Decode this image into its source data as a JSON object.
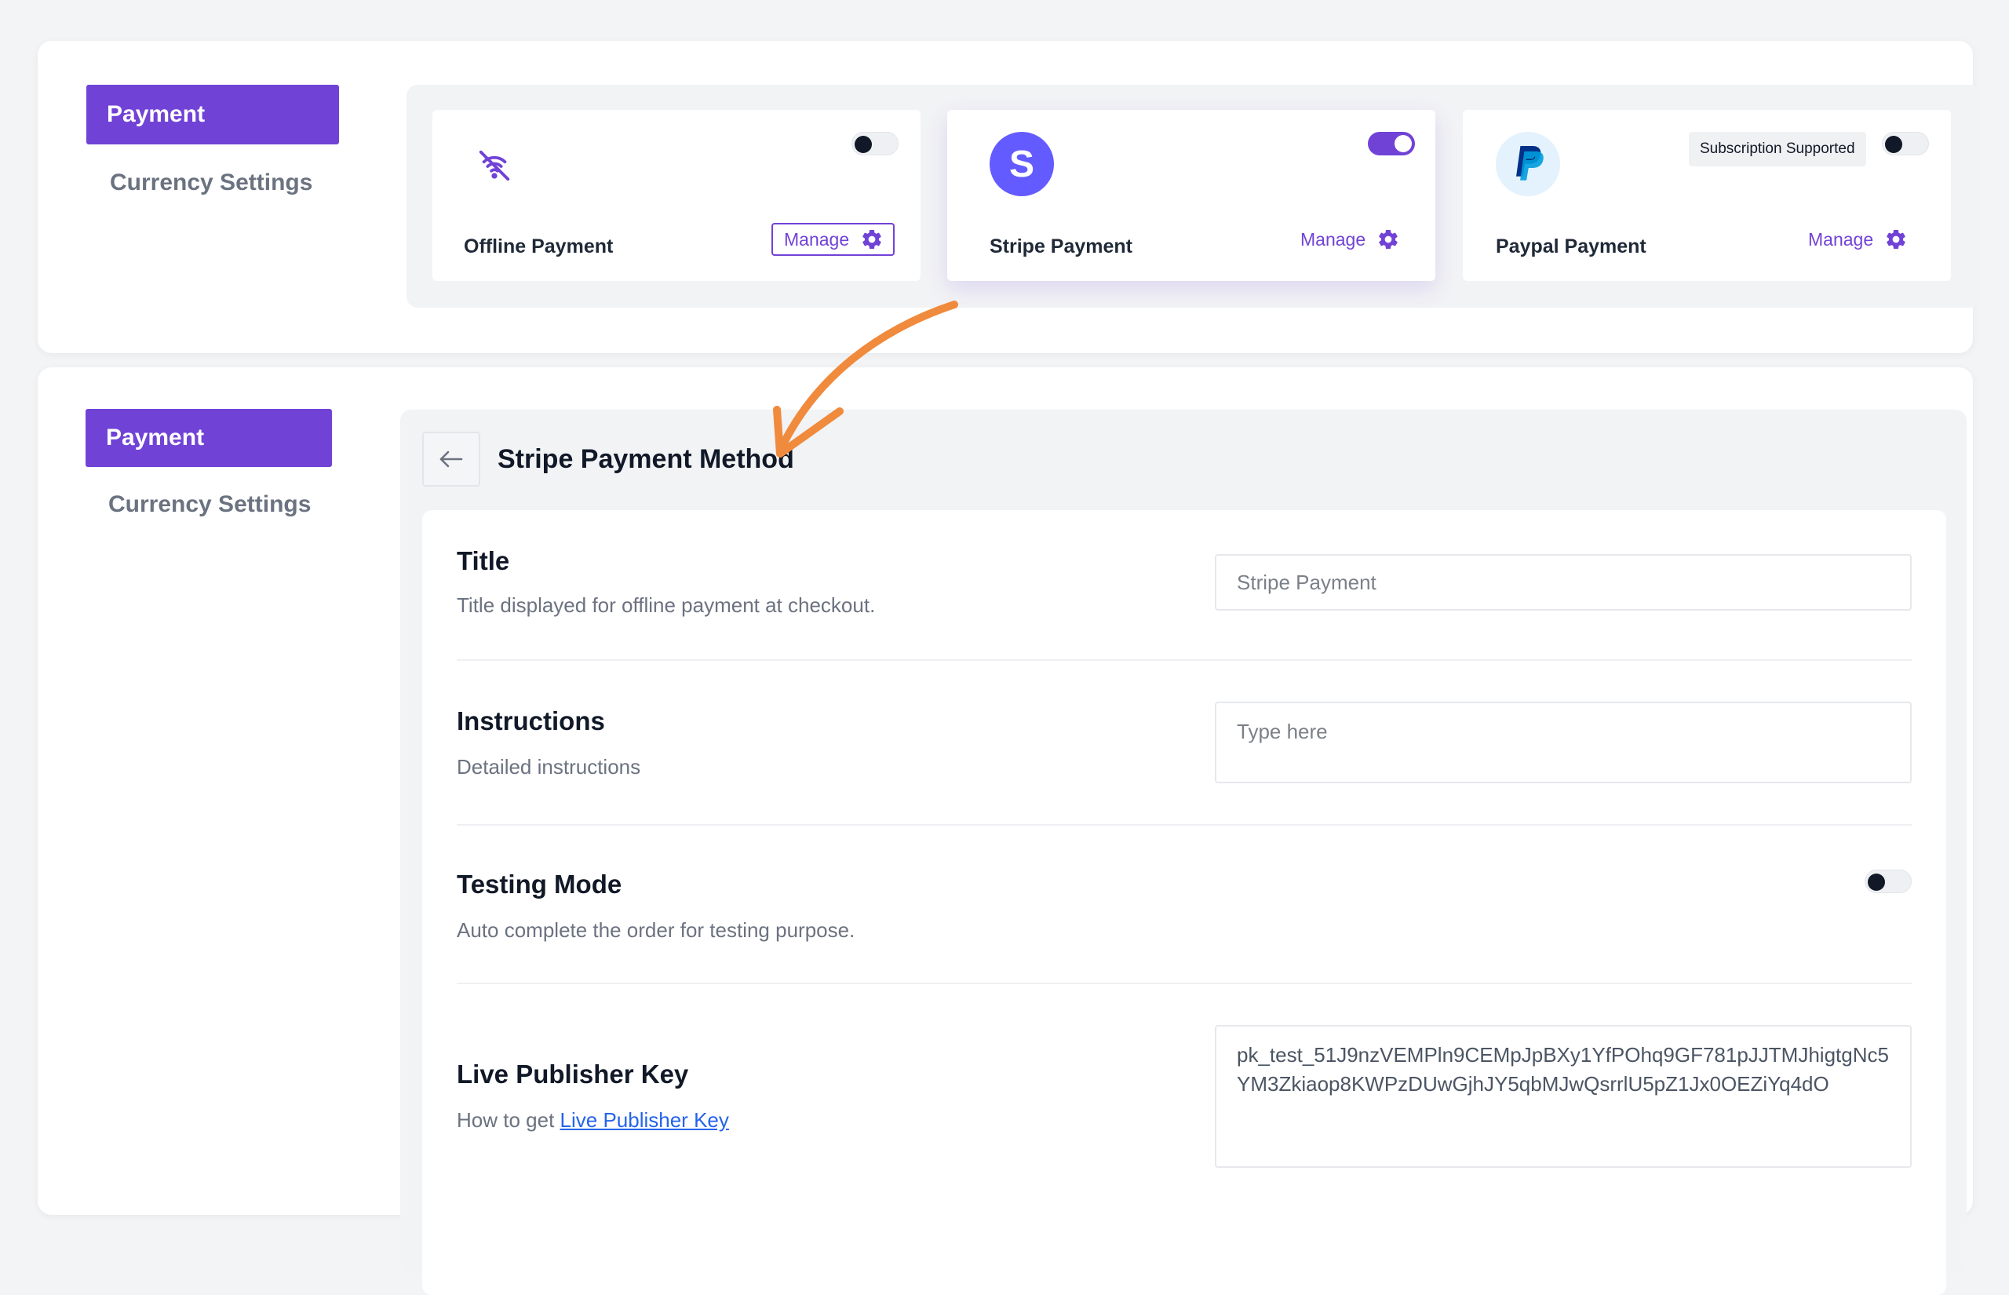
{
  "colors": {
    "accent": "#7142d6",
    "arrow": "#f08a3c",
    "link": "#2563eb"
  },
  "top": {
    "nav": {
      "active": "Payment",
      "link": "Currency Settings"
    },
    "cards": [
      {
        "name": "Offline Payment",
        "manage": "Manage",
        "enabled": false,
        "icon": "wifi-off-icon"
      },
      {
        "name": "Stripe Payment",
        "manage": "Manage",
        "enabled": true,
        "icon": "stripe-logo-icon",
        "logo_letter": "S"
      },
      {
        "name": "Paypal Payment",
        "manage": "Manage",
        "enabled": false,
        "icon": "paypal-logo-icon",
        "badge": "Subscription Supported"
      }
    ]
  },
  "bottom": {
    "nav": {
      "active": "Payment",
      "link": "Currency Settings"
    },
    "title": "Stripe Payment Method",
    "rows": {
      "title": {
        "label": "Title",
        "desc": "Title displayed for offline payment at checkout.",
        "placeholder": "Stripe Payment"
      },
      "instructions": {
        "label": "Instructions",
        "desc": "Detailed instructions",
        "placeholder": "Type here"
      },
      "testing": {
        "label": "Testing Mode",
        "desc": "Auto complete the order for testing purpose.",
        "enabled": false
      },
      "live_key": {
        "label": "Live Publisher Key",
        "desc_prefix": "How to get",
        "desc_link": "Live Publisher Key",
        "value": "pk_test_51J9nzVEMPln9CEMpJpBXy1YfPOhq9GF781pJJTMJhigtgNc5YM3Zkiaop8KWPzDUwGjhJY5qbMJwQsrrlU5pZ1Jx0OEZiYq4dO"
      }
    }
  }
}
